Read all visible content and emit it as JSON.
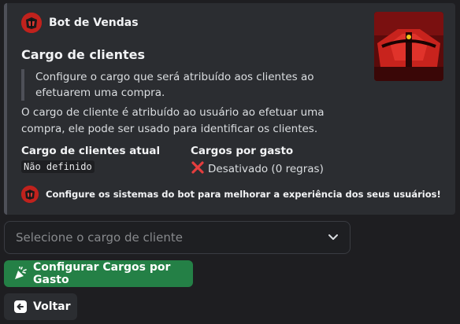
{
  "embed": {
    "author_name": "Bot de Vendas",
    "title": "Cargo de clientes",
    "quote": "Configure o cargo que será atribuído aos clientes ao efetuarem uma compra.",
    "description": "O cargo de cliente é atribuído ao usuário ao efetuar uma compra, ele pode ser usado para identificar os clientes.",
    "fields": [
      {
        "name": "Cargo de clientes atual",
        "value": "Não definido"
      },
      {
        "name": "Cargos por gasto",
        "value": "Desativado (0 regras)"
      }
    ],
    "footer": "Configure os sistemas do bot para melhorar a experiência dos seus usuários!"
  },
  "select": {
    "placeholder": "Selecione o cargo de cliente"
  },
  "buttons": {
    "configure_label": "Configurar Cargos por Gasto",
    "back_label": "Voltar"
  },
  "colors": {
    "accent_green": "#248046",
    "error_red": "#e53e3e",
    "embed_bg": "#2b2d31"
  }
}
